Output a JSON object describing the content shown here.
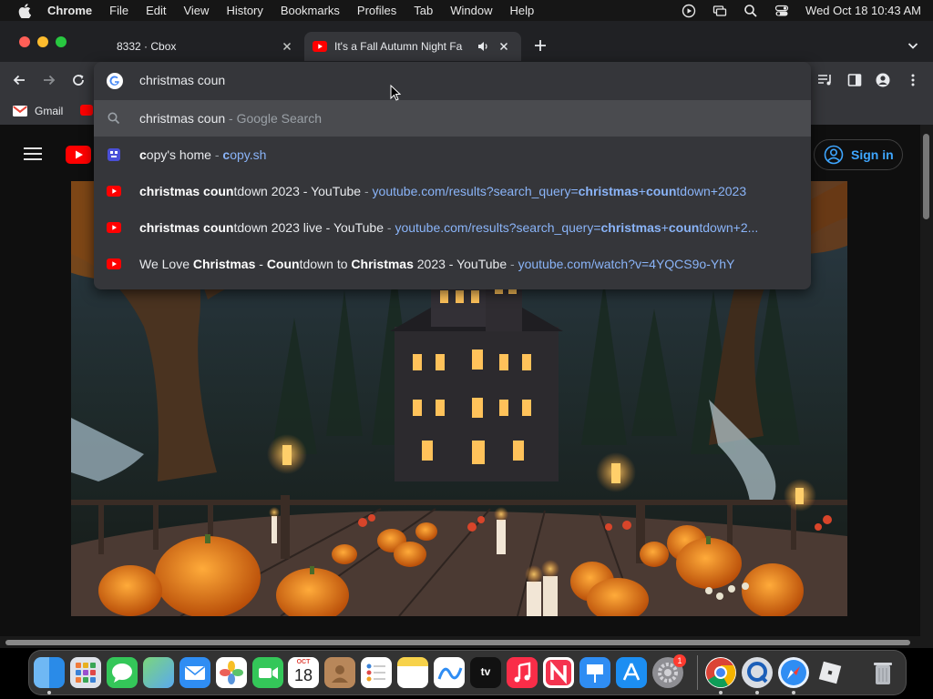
{
  "menubar": {
    "app_name": "Chrome",
    "items": [
      "File",
      "Edit",
      "View",
      "History",
      "Bookmarks",
      "Profiles",
      "Tab",
      "Window",
      "Help"
    ],
    "clock": "Wed Oct 18  10:43 AM"
  },
  "tabs": [
    {
      "title": "8332 · Cbox",
      "active": false
    },
    {
      "title": "It's a Fall Autumn Night Fa",
      "active": true,
      "audio": true
    }
  ],
  "bookmarks": {
    "items": [
      {
        "label": "Gmail"
      }
    ]
  },
  "omnibox": {
    "query": "christmas coun",
    "suggestions": [
      {
        "kind": "search",
        "parts": [
          {
            "t": "christmas coun",
            "s": "n"
          },
          {
            "t": " - Google Search",
            "s": "dim"
          }
        ]
      },
      {
        "kind": "bookmark",
        "parts": [
          {
            "t": "c",
            "s": "b"
          },
          {
            "t": "opy's home",
            "s": "n"
          },
          {
            "t": " - ",
            "s": "dim"
          },
          {
            "t": "c",
            "s": "urlb"
          },
          {
            "t": "opy.sh",
            "s": "url"
          }
        ]
      },
      {
        "kind": "youtube",
        "parts": [
          {
            "t": "christmas coun",
            "s": "b"
          },
          {
            "t": "tdown 2023 - YouTube",
            "s": "n"
          },
          {
            "t": " - ",
            "s": "dim"
          },
          {
            "t": "youtube.com/results?search_query=",
            "s": "url"
          },
          {
            "t": "christmas",
            "s": "urlb"
          },
          {
            "t": "+",
            "s": "url"
          },
          {
            "t": "coun",
            "s": "urlb"
          },
          {
            "t": "tdown+2023",
            "s": "url"
          }
        ]
      },
      {
        "kind": "youtube",
        "parts": [
          {
            "t": "christmas coun",
            "s": "b"
          },
          {
            "t": "tdown 2023 live - YouTube",
            "s": "n"
          },
          {
            "t": " - ",
            "s": "dim"
          },
          {
            "t": "youtube.com/results?search_query=",
            "s": "url"
          },
          {
            "t": "christmas",
            "s": "urlb"
          },
          {
            "t": "+",
            "s": "url"
          },
          {
            "t": "coun",
            "s": "urlb"
          },
          {
            "t": "tdown+2...",
            "s": "url"
          }
        ]
      },
      {
        "kind": "youtube",
        "parts": [
          {
            "t": "We Love ",
            "s": "n"
          },
          {
            "t": "Christmas",
            "s": "b"
          },
          {
            "t": " - ",
            "s": "n"
          },
          {
            "t": "Coun",
            "s": "b"
          },
          {
            "t": "tdown to ",
            "s": "n"
          },
          {
            "t": "Christmas",
            "s": "b"
          },
          {
            "t": " 2023 - YouTube",
            "s": "n"
          },
          {
            "t": " - ",
            "s": "dim"
          },
          {
            "t": "youtube.com/watch?v=4YQCS9o-YhY",
            "s": "url"
          }
        ]
      }
    ]
  },
  "youtube": {
    "sign_in": "Sign in"
  },
  "calendar_icon": {
    "month": "OCT",
    "day": "18"
  },
  "dock": {
    "badge_count": "1",
    "apps": [
      "finder-icon",
      "launchpad-icon",
      "messages-icon",
      "maps-icon",
      "mail-icon",
      "photos-icon",
      "facetime-icon",
      "calendar-icon",
      "contacts-icon",
      "reminders-icon",
      "notes-icon",
      "freeform-icon",
      "apple-tv-icon",
      "music-icon",
      "news-icon",
      "keynote-icon",
      "app-store-icon",
      "system-settings-icon",
      "chrome-icon",
      "quicktime-icon",
      "safari-icon",
      "roblox-icon",
      "trash-icon"
    ]
  },
  "colors": {
    "chrome_toolbar": "#35363a",
    "tabstrip": "#202124",
    "url_blue": "#8ab4f8",
    "youtube_red": "#ff0000",
    "signin_blue": "#3ea6ff"
  }
}
